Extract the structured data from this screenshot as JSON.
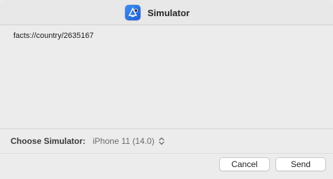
{
  "window": {
    "title": "Simulator",
    "app_icon": "simulator-app-icon"
  },
  "content": {
    "url_text": "facts://country/2635167"
  },
  "simulator_picker": {
    "label": "Choose Simulator:",
    "selected": "iPhone 11 (14.0)",
    "icon": "chevron-up-down-icon"
  },
  "buttons": {
    "cancel_label": "Cancel",
    "send_label": "Send"
  },
  "colors": {
    "window_bg": "#ececec",
    "accent_icon": "#2f7bf0"
  }
}
